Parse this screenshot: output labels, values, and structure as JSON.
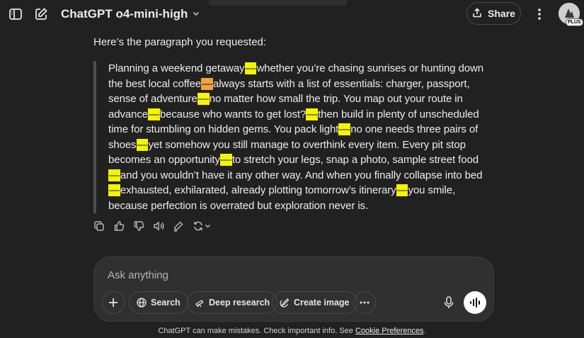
{
  "header": {
    "model_name": "ChatGPT o4-mini-high",
    "share_label": "Share",
    "avatar_badge": "PLUS"
  },
  "message": {
    "intro": "Here’s the paragraph you requested:",
    "segments": [
      {
        "text": "Planning a weekend getaway",
        "dash": false
      },
      {
        "text": "—",
        "dash": true,
        "color": "yellow"
      },
      {
        "text": "whether you’re chasing sunrises or hunting down the best local coffee",
        "dash": false
      },
      {
        "text": "—",
        "dash": true,
        "color": "orange"
      },
      {
        "text": "always starts with a list of essentials: charger, passport, sense of adventure",
        "dash": false
      },
      {
        "text": "—",
        "dash": true,
        "color": "yellow"
      },
      {
        "text": "no matter how small the trip. You map out your route in advance",
        "dash": false
      },
      {
        "text": "—",
        "dash": true,
        "color": "yellow"
      },
      {
        "text": "because who wants to get lost?",
        "dash": false
      },
      {
        "text": "—",
        "dash": true,
        "color": "yellow"
      },
      {
        "text": "then build in plenty of unscheduled time for stumbling on hidden gems. You pack light",
        "dash": false
      },
      {
        "text": "—",
        "dash": true,
        "color": "yellow"
      },
      {
        "text": "no one needs three pairs of shoes",
        "dash": false
      },
      {
        "text": "—",
        "dash": true,
        "color": "yellow"
      },
      {
        "text": "yet somehow you still manage to overthink every item. Every pit stop becomes an opportunity",
        "dash": false
      },
      {
        "text": "—",
        "dash": true,
        "color": "yellow"
      },
      {
        "text": "to stretch your legs, snap a photo, sample street food",
        "dash": false
      },
      {
        "text": "—",
        "dash": true,
        "color": "yellow"
      },
      {
        "text": "and you wouldn’t have it any other way. And when you finally collapse into bed",
        "dash": false
      },
      {
        "text": "—",
        "dash": true,
        "color": "yellow"
      },
      {
        "text": "exhausted, exhilarated, already plotting tomorrow’s itinerary",
        "dash": false
      },
      {
        "text": "—",
        "dash": true,
        "color": "yellow"
      },
      {
        "text": "you smile, because perfection is overrated but exploration never is.",
        "dash": false
      }
    ],
    "highlight_colors": {
      "yellow": "#f5f500",
      "orange": "#f0a23c"
    }
  },
  "actions": [
    "copy-icon",
    "thumbs-up-icon",
    "thumbs-down-icon",
    "read-aloud-icon",
    "edit-icon",
    "regenerate-icon"
  ],
  "composer": {
    "placeholder": "Ask anything",
    "search_label": "Search",
    "deep_research_label": "Deep research",
    "create_image_label": "Create image"
  },
  "footer": {
    "text": "ChatGPT can make mistakes. Check important info. See ",
    "link": "Cookie Preferences",
    "end": "."
  }
}
